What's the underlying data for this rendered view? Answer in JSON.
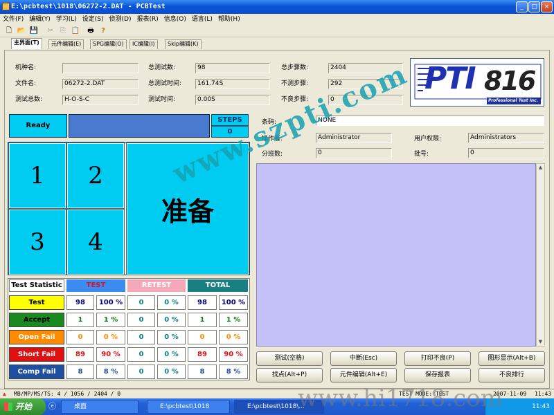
{
  "window": {
    "title": "E:\\pcbtest\\1018\\06272-2.DAT - PCBTest",
    "min": "_",
    "max": "□",
    "close": "×"
  },
  "menu": [
    "文件(F)",
    "编辑(Y)",
    "学习(L)",
    "设定(S)",
    "侦测(D)",
    "报表(R)",
    "信息(O)",
    "语言(L)",
    "帮助(H)"
  ],
  "tabs": [
    "主界面(T)",
    "元件编辑(E)",
    "SPG编辑(O)",
    "IC编辑(I)",
    "Skip编辑(K)"
  ],
  "info": {
    "model_label": "机种名:",
    "model_value": "",
    "file_label": "文件名:",
    "file_value": "06272-2.DAT",
    "total_test_label": "测试总数:",
    "total_test_value": "H-O-S-C",
    "total_tests_label": "总测试数:",
    "total_tests_value": "98",
    "total_time_label": "总测试时间:",
    "total_time_value": "161.74S",
    "test_time_label": "测试时间:",
    "test_time_value": "0.00S",
    "total_steps_label": "总步骤数:",
    "total_steps_value": "2404",
    "untested_label": "不测步骤:",
    "untested_value": "292",
    "bad_steps_label": "不良步骤:",
    "bad_steps_value": "0"
  },
  "logo": {
    "brand": "PTI",
    "model": "816",
    "tagline": "Professional Test Inc."
  },
  "status": {
    "ready": "Ready",
    "steps_label": "STEPS",
    "steps_value": "0"
  },
  "slots": [
    "1",
    "2",
    "3",
    "4"
  ],
  "big_status": "准备",
  "stats": {
    "header": "Test Statistic",
    "col_test": "TEST",
    "col_retest": "RETEST",
    "col_total": "TOTAL",
    "rows": [
      {
        "label": "Test",
        "t": "98",
        "tp": "100 %",
        "r": "0",
        "rp": "0 %",
        "o": "98",
        "op": "100 %"
      },
      {
        "label": "Accept",
        "t": "1",
        "tp": "1 %",
        "r": "0",
        "rp": "0 %",
        "o": "1",
        "op": "1 %"
      },
      {
        "label": "Open Fail",
        "t": "0",
        "tp": "0 %",
        "r": "0",
        "rp": "0 %",
        "o": "0",
        "op": "0 %"
      },
      {
        "label": "Short Fail",
        "t": "89",
        "tp": "90 %",
        "r": "0",
        "rp": "0 %",
        "o": "89",
        "op": "90 %"
      },
      {
        "label": "Comp Fail",
        "t": "8",
        "tp": "8 %",
        "r": "0",
        "rp": "0 %",
        "o": "8",
        "op": "8 %"
      }
    ]
  },
  "details": {
    "barcode_label": "条码:",
    "barcode_value": "NONE",
    "operator_label": "操作者:",
    "operator_value": "Administrator",
    "perm_label": "用户权限:",
    "perm_value": "Administrators",
    "shift_label": "分班数:",
    "shift_value": "0",
    "batch_label": "批号:",
    "batch_value": "0"
  },
  "buttons": [
    "测试(空格)",
    "中断(Esc)",
    "打印不良(P)",
    "图形显示(Alt+B)",
    "找点(Alt+P)",
    "元件编辑(Alt+E)",
    "保存报表",
    "不良排行"
  ],
  "statusbar": {
    "left": "MB/MP/MS/TS: 4 / 1056 / 2404 / 0",
    "mode": "TEST MODE: TEST",
    "date": "2007-11-09",
    "time": "11:43"
  },
  "taskbar": {
    "start": "开始",
    "items": [
      "桌面",
      "E:\\pcbtest\\1018",
      "E:\\pcbtest\\1018\\..."
    ],
    "clock": "11:43"
  },
  "watermark": {
    "main": "www.szpti.com",
    "bottom": "www.hi1718.com"
  }
}
